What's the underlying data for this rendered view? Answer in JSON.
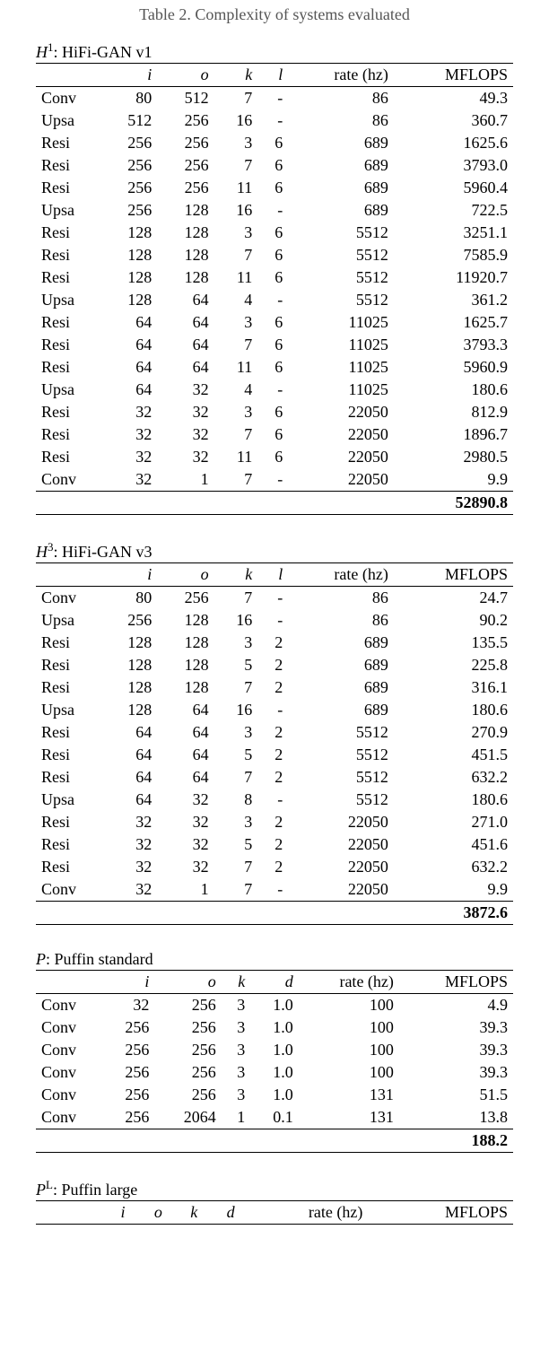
{
  "caption": "Table 2. Complexity of systems evaluated",
  "tables": [
    {
      "label_prefix": "H",
      "label_sup": "1",
      "label_rest": ": HiFi-GAN v1",
      "headers": [
        "",
        "i",
        "o",
        "k",
        "l",
        "rate (hz)",
        "MFLOPS"
      ],
      "rows": [
        [
          "Conv",
          "80",
          "512",
          "7",
          "-",
          "86",
          "49.3"
        ],
        [
          "Upsa",
          "512",
          "256",
          "16",
          "-",
          "86",
          "360.7"
        ],
        [
          "Resi",
          "256",
          "256",
          "3",
          "6",
          "689",
          "1625.6"
        ],
        [
          "Resi",
          "256",
          "256",
          "7",
          "6",
          "689",
          "3793.0"
        ],
        [
          "Resi",
          "256",
          "256",
          "11",
          "6",
          "689",
          "5960.4"
        ],
        [
          "Upsa",
          "256",
          "128",
          "16",
          "-",
          "689",
          "722.5"
        ],
        [
          "Resi",
          "128",
          "128",
          "3",
          "6",
          "5512",
          "3251.1"
        ],
        [
          "Resi",
          "128",
          "128",
          "7",
          "6",
          "5512",
          "7585.9"
        ],
        [
          "Resi",
          "128",
          "128",
          "11",
          "6",
          "5512",
          "11920.7"
        ],
        [
          "Upsa",
          "128",
          "64",
          "4",
          "-",
          "5512",
          "361.2"
        ],
        [
          "Resi",
          "64",
          "64",
          "3",
          "6",
          "11025",
          "1625.7"
        ],
        [
          "Resi",
          "64",
          "64",
          "7",
          "6",
          "11025",
          "3793.3"
        ],
        [
          "Resi",
          "64",
          "64",
          "11",
          "6",
          "11025",
          "5960.9"
        ],
        [
          "Upsa",
          "64",
          "32",
          "4",
          "-",
          "11025",
          "180.6"
        ],
        [
          "Resi",
          "32",
          "32",
          "3",
          "6",
          "22050",
          "812.9"
        ],
        [
          "Resi",
          "32",
          "32",
          "7",
          "6",
          "22050",
          "1896.7"
        ],
        [
          "Resi",
          "32",
          "32",
          "11",
          "6",
          "22050",
          "2980.5"
        ],
        [
          "Conv",
          "32",
          "1",
          "7",
          "-",
          "22050",
          "9.9"
        ]
      ],
      "total": "52890.8"
    },
    {
      "label_prefix": "H",
      "label_sup": "3",
      "label_rest": ": HiFi-GAN v3",
      "headers": [
        "",
        "i",
        "o",
        "k",
        "l",
        "rate (hz)",
        "MFLOPS"
      ],
      "rows": [
        [
          "Conv",
          "80",
          "256",
          "7",
          "-",
          "86",
          "24.7"
        ],
        [
          "Upsa",
          "256",
          "128",
          "16",
          "-",
          "86",
          "90.2"
        ],
        [
          "Resi",
          "128",
          "128",
          "3",
          "2",
          "689",
          "135.5"
        ],
        [
          "Resi",
          "128",
          "128",
          "5",
          "2",
          "689",
          "225.8"
        ],
        [
          "Resi",
          "128",
          "128",
          "7",
          "2",
          "689",
          "316.1"
        ],
        [
          "Upsa",
          "128",
          "64",
          "16",
          "-",
          "689",
          "180.6"
        ],
        [
          "Resi",
          "64",
          "64",
          "3",
          "2",
          "5512",
          "270.9"
        ],
        [
          "Resi",
          "64",
          "64",
          "5",
          "2",
          "5512",
          "451.5"
        ],
        [
          "Resi",
          "64",
          "64",
          "7",
          "2",
          "5512",
          "632.2"
        ],
        [
          "Upsa",
          "64",
          "32",
          "8",
          "-",
          "5512",
          "180.6"
        ],
        [
          "Resi",
          "32",
          "32",
          "3",
          "2",
          "22050",
          "271.0"
        ],
        [
          "Resi",
          "32",
          "32",
          "5",
          "2",
          "22050",
          "451.6"
        ],
        [
          "Resi",
          "32",
          "32",
          "7",
          "2",
          "22050",
          "632.2"
        ],
        [
          "Conv",
          "32",
          "1",
          "7",
          "-",
          "22050",
          "9.9"
        ]
      ],
      "total": "3872.6"
    },
    {
      "label_prefix": "P",
      "label_sup": "",
      "label_rest": ": Puffin standard",
      "headers": [
        "",
        "i",
        "o",
        "k",
        "d",
        "rate (hz)",
        "MFLOPS"
      ],
      "rows": [
        [
          "Conv",
          "32",
          "256",
          "3",
          "1.0",
          "100",
          "4.9"
        ],
        [
          "Conv",
          "256",
          "256",
          "3",
          "1.0",
          "100",
          "39.3"
        ],
        [
          "Conv",
          "256",
          "256",
          "3",
          "1.0",
          "100",
          "39.3"
        ],
        [
          "Conv",
          "256",
          "256",
          "3",
          "1.0",
          "100",
          "39.3"
        ],
        [
          "Conv",
          "256",
          "256",
          "3",
          "1.0",
          "131",
          "51.5"
        ],
        [
          "Conv",
          "256",
          "2064",
          "1",
          "0.1",
          "131",
          "13.8"
        ]
      ],
      "total": "188.2"
    },
    {
      "label_prefix": "P",
      "label_sup": "L",
      "label_rest": ": Puffin large",
      "headers": [
        "",
        "i",
        "o",
        "k",
        "d",
        "rate (hz)",
        "MFLOPS"
      ],
      "rows": [],
      "total": null,
      "partial": true
    }
  ]
}
